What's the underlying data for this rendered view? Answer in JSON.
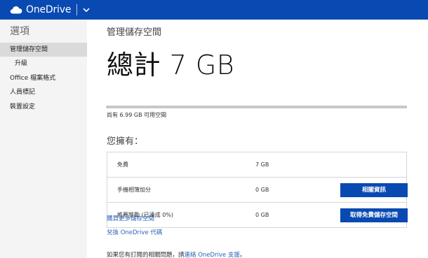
{
  "header": {
    "brand": "OneDrive",
    "logo_icon": "cloud-icon",
    "menu_icon": "chevron-down-icon",
    "background": "#094ab2"
  },
  "sidebar": {
    "title": "選項",
    "items": [
      {
        "label": "管理儲存空間",
        "active": true
      },
      {
        "label": "升級"
      },
      {
        "label": "Office 檔案格式"
      },
      {
        "label": "人員標記"
      },
      {
        "label": "裝置設定"
      }
    ]
  },
  "main": {
    "page_title": "管理儲存空間",
    "total": "總計 7 GB",
    "usage_fraction": 0.001,
    "available_text": "尚有 6.99 GB 可用空間",
    "own_title": "您擁有：",
    "rows": [
      {
        "name": "免費",
        "size": "7 GB",
        "button": ""
      },
      {
        "name": "手機相簿加分",
        "size": "0 GB",
        "button": "相關資訊"
      },
      {
        "name": "推薦獎勵 (已達成 0%)",
        "size": "0 GB",
        "button": "取得免費儲存空間"
      }
    ],
    "links": {
      "buy_more": "購買更多儲存空間",
      "redeem": "兌換 OneDrive 代碼"
    },
    "footer": {
      "prefix": "如果您有訂閱的相關問題，請",
      "link": "連絡 OneDrive 支援",
      "suffix": "。"
    },
    "accent": "#094ab2",
    "link_color": "#2a62b8"
  }
}
